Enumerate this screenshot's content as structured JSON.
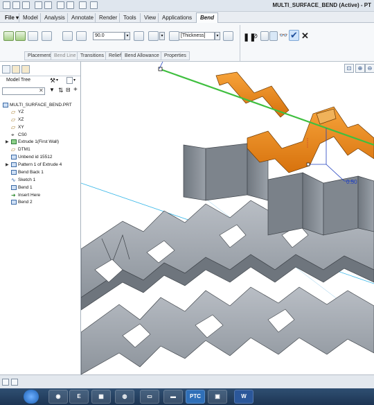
{
  "window": {
    "title": "MULTI_SURFACE_BEND (Active) - PT"
  },
  "menu": {
    "file": "File ▾",
    "tabs": [
      "Model",
      "Analysis",
      "Annotate",
      "Render",
      "Tools",
      "View",
      "Applications",
      "Bend"
    ],
    "active_tab": "Bend"
  },
  "ribbon": {
    "angle_value": "90.0",
    "thickness_value": "[Thickness]",
    "subtabs": [
      "Placement",
      "Bend Line",
      "Transitions",
      "Relief",
      "Bend Allowance",
      "Properties"
    ]
  },
  "model_tree": {
    "title": "Model Tree",
    "root": "MULTI_SURFACE_BEND.PRT",
    "items": [
      {
        "label": "YZ",
        "icon": "datum-plane-icon"
      },
      {
        "label": "XZ",
        "icon": "datum-plane-icon"
      },
      {
        "label": "XY",
        "icon": "datum-plane-icon"
      },
      {
        "label": "CS0",
        "icon": "coordinate-system-icon"
      },
      {
        "label": "Extrude 1(First Wall)",
        "icon": "extrude-icon",
        "expandable": true
      },
      {
        "label": "DTM1",
        "icon": "datum-plane-icon"
      },
      {
        "label": "Unbend id 15512",
        "icon": "unbend-icon"
      },
      {
        "label": "Pattern 1 of Extrude 4",
        "icon": "pattern-icon",
        "expandable": true
      },
      {
        "label": "Bend Back 1",
        "icon": "bend-back-icon"
      },
      {
        "label": "Sketch 1",
        "icon": "sketch-icon"
      },
      {
        "label": "Bend 1",
        "icon": "bend-icon"
      },
      {
        "label": "Insert Here",
        "icon": "insert-arrow-icon"
      },
      {
        "label": "Bend 2",
        "icon": "bend-icon"
      }
    ]
  },
  "viewport": {
    "dimension_label": "0.50"
  },
  "colors": {
    "orange": "#e8891a",
    "gray_sheet": "#8e949c",
    "green_line": "#3fbf3f",
    "blue": "#1f3fbf"
  },
  "taskbar": {
    "ptc_label": "PTC",
    "word_label": "W"
  }
}
